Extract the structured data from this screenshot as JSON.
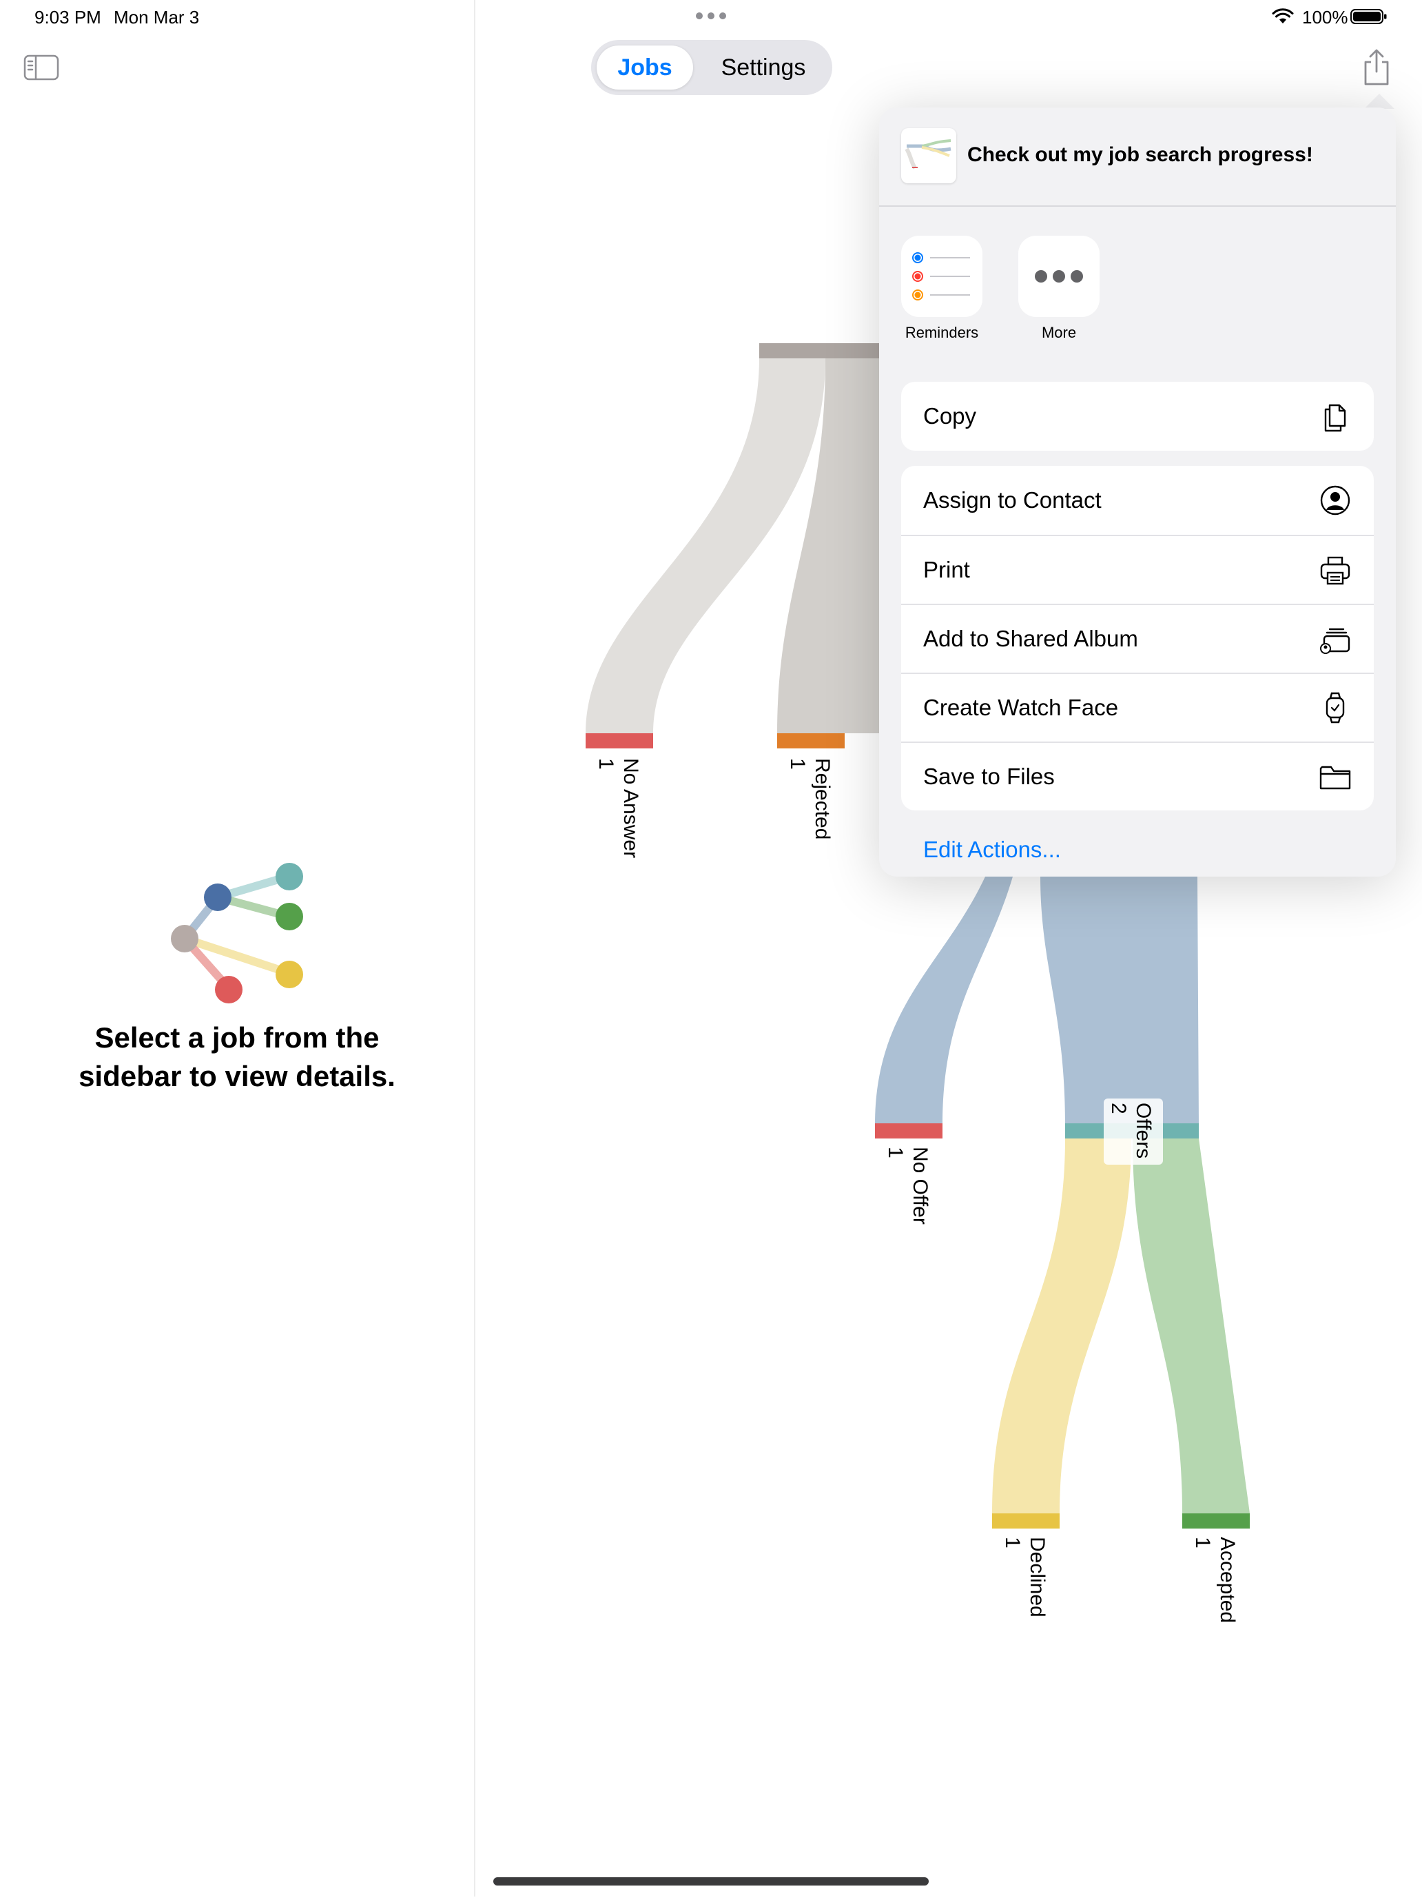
{
  "status_bar": {
    "time": "9:03 PM",
    "date": "Mon Mar 3",
    "battery_percent": "100%"
  },
  "sidebar": {
    "toggle_icon": "sidebar-toggle-icon",
    "empty_state_text": "Select a job from the sidebar to view details.",
    "logo_colors": [
      "#b5aaa6",
      "#4a6fa5",
      "#6fb3b0",
      "#55a04a",
      "#e7c444",
      "#de5a5a"
    ]
  },
  "segmented": {
    "jobs_label": "Jobs",
    "settings_label": "Settings",
    "selected": "Jobs"
  },
  "toolbar": {
    "share_icon": "share-icon"
  },
  "share_sheet": {
    "title": "Check out my job search progress!",
    "apps": [
      {
        "label": "Reminders",
        "icon": "reminders-icon"
      },
      {
        "label": "More",
        "icon": "more-icon"
      }
    ],
    "copy_label": "Copy",
    "actions": [
      {
        "label": "Assign to Contact",
        "icon": "person-circle-icon"
      },
      {
        "label": "Print",
        "icon": "printer-icon"
      },
      {
        "label": "Add to Shared Album",
        "icon": "shared-album-icon"
      },
      {
        "label": "Create Watch Face",
        "icon": "watch-icon"
      },
      {
        "label": "Save to Files",
        "icon": "folder-icon"
      }
    ],
    "edit_actions_label": "Edit Actions..."
  },
  "sankey": {
    "nodes": [
      {
        "name": "No Answer",
        "value": "1",
        "color": "#de5a5a"
      },
      {
        "name": "Rejected",
        "value": "1",
        "color": "#e07e2a"
      },
      {
        "name": "No Offer",
        "value": "1",
        "color": "#de5a5a"
      },
      {
        "name": "Offers",
        "value": "2",
        "color": "#6fb3b0"
      },
      {
        "name": "Declined",
        "value": "1",
        "color": "#e7c444"
      },
      {
        "name": "Accepted",
        "value": "1",
        "color": "#55a04a"
      }
    ],
    "colors": {
      "applied": "#aca5a1",
      "flow_gray": "#e1dfdc",
      "flow_gray_dark": "#d2cfcb",
      "flow_blue": "#acc0d4",
      "flow_yellow": "#f5e6ab",
      "flow_green": "#b5d7b0"
    }
  }
}
